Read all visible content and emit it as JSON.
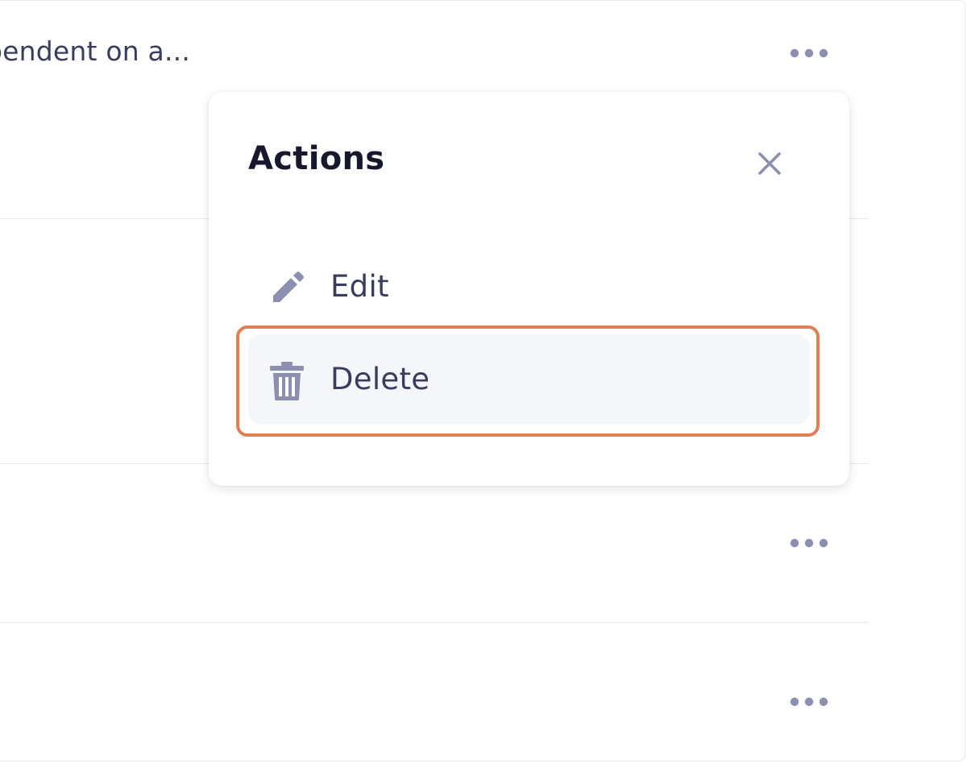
{
  "rows": [
    {
      "text": "pendent on a..."
    },
    {
      "text": ""
    },
    {
      "text": ""
    },
    {
      "text": ""
    }
  ],
  "row_menu": {
    "icon": "more-horizontal-icon"
  },
  "popover": {
    "title": "Actions",
    "close_icon": "close-icon",
    "items": [
      {
        "label": "Edit",
        "icon": "pencil-icon"
      },
      {
        "label": "Delete",
        "icon": "trash-icon"
      }
    ]
  },
  "colors": {
    "text": "#3a3c5c",
    "title": "#17182e",
    "icon": "#8d8fb1",
    "highlight": "#e07f53",
    "hover_bg": "#f5f6fa"
  }
}
